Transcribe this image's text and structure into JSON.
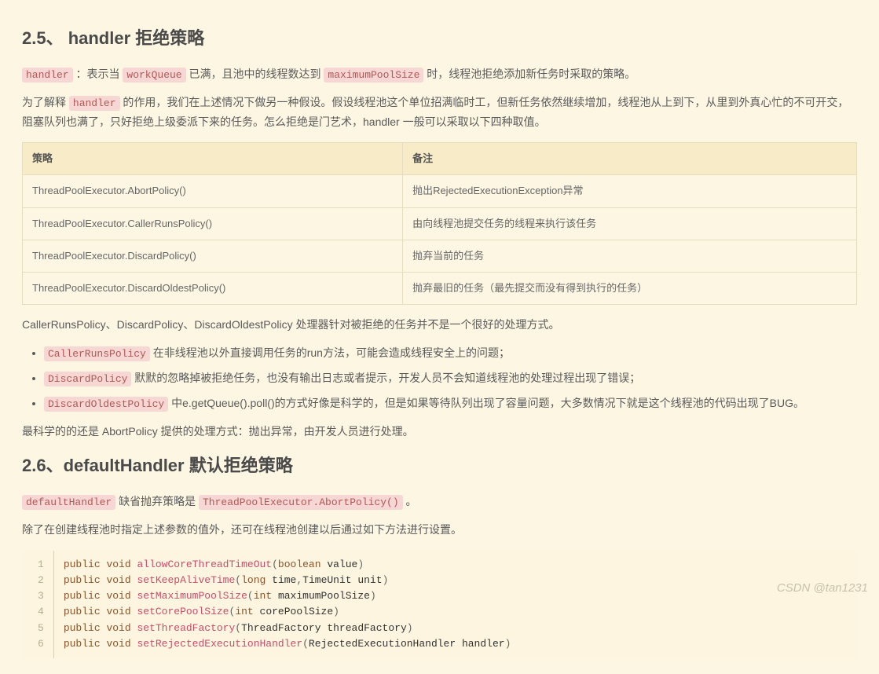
{
  "sec25": {
    "heading": "2.5、 handler 拒绝策略",
    "intro": {
      "c1": "handler",
      "t1": " ：表示当 ",
      "c2": "workQueue",
      "t2": " 已满，且池中的线程数达到 ",
      "c3": "maximumPoolSize",
      "t3": " 时，线程池拒绝添加新任务时采取的策略。"
    },
    "para2": {
      "t1": "为了解释 ",
      "c1": "handler",
      "t2": " 的作用，我们在上述情况下做另一种假设。假设线程池这个单位招满临时工，但新任务依然继续增加，线程池从上到下，从里到外真心忙的不可开交，阻塞队列也满了，只好拒绝上级委派下来的任务。怎么拒绝是门艺术，handler 一般可以采取以下四种取值。"
    },
    "table": {
      "h1": "策略",
      "h2": "备注",
      "rows": [
        {
          "c1": "ThreadPoolExecutor.AbortPolicy()",
          "c2": "抛出RejectedExecutionException异常"
        },
        {
          "c1": "ThreadPoolExecutor.CallerRunsPolicy()",
          "c2": "由向线程池提交任务的线程来执行该任务"
        },
        {
          "c1": "ThreadPoolExecutor.DiscardPolicy()",
          "c2": "抛弃当前的任务"
        },
        {
          "c1": "ThreadPoolExecutor.DiscardOldestPolicy()",
          "c2": "抛弃最旧的任务（最先提交而没有得到执行的任务）"
        }
      ]
    },
    "note1": "CallerRunsPolicy、DiscardPolicy、DiscardOldestPolicy 处理器针对被拒绝的任务并不是一个很好的处理方式。",
    "bullets": [
      {
        "code": "CallerRunsPolicy",
        "text": " 在非线程池以外直接调用任务的run方法，可能会造成线程安全上的问题；"
      },
      {
        "code": "DiscardPolicy",
        "text": " 默默的忽略掉被拒绝任务，也没有输出日志或者提示，开发人员不会知道线程池的处理过程出现了错误；"
      },
      {
        "code": "DiscardOldestPolicy",
        "text": " 中e.getQueue().poll()的方式好像是科学的，但是如果等待队列出现了容量问题，大多数情况下就是这个线程池的代码出现了BUG。"
      }
    ],
    "note2": "最科学的的还是 AbortPolicy 提供的处理方式：抛出异常，由开发人员进行处理。"
  },
  "sec26": {
    "heading": "2.6、defaultHandler 默认拒绝策略",
    "p1": {
      "c1": "defaultHandler",
      "t1": " 缺省抛弃策略是 ",
      "c2": "ThreadPoolExecutor.AbortPolicy()",
      "t2": " 。"
    },
    "p2": "除了在创建线程池时指定上述参数的值外，还可在线程池创建以后通过如下方法进行设置。",
    "ln": {
      "1": "1",
      "2": "2",
      "3": "3",
      "4": "4",
      "5": "5",
      "6": "6"
    },
    "kw_public": "public",
    "kw_void": "void",
    "kw_boolean": "boolean",
    "kw_long": "long",
    "kw_int": "int",
    "fn1": "allowCoreThreadTimeOut",
    "var1": "value",
    "fn2": "setKeepAliveTime",
    "var2a": "time",
    "var2b": "TimeUnit unit",
    "fn3": "setMaximumPoolSize",
    "var3": "maximumPoolSize",
    "fn4": "setCorePoolSize",
    "var4": "corePoolSize",
    "fn5": "setThreadFactory",
    "var5": "ThreadFactory threadFactory",
    "fn6": "setRejectedExecutionHandler",
    "var6": "RejectedExecutionHandler  handler"
  },
  "watermark": "CSDN @tan1231"
}
